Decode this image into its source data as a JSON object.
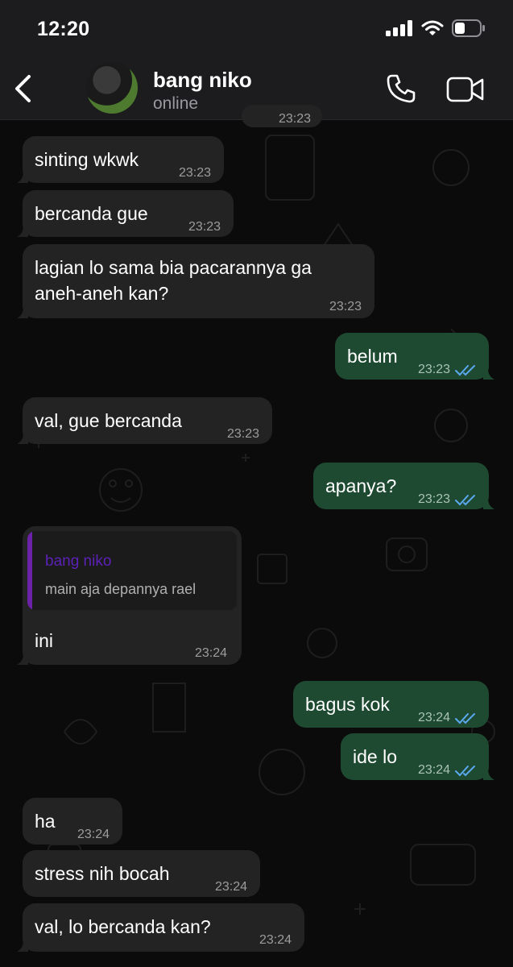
{
  "status_bar": {
    "time": "12:20"
  },
  "header": {
    "name": "bang niko",
    "status": "online"
  },
  "partial_top_time": "23:23",
  "messages": [
    {
      "text": "sinting wkwk",
      "time": "23:23"
    },
    {
      "text": "bercanda gue",
      "time": "23:23"
    },
    {
      "text_line1": "lagian lo sama bia pacarannya ga",
      "text_line2": "aneh-aneh kan?",
      "time": "23:23"
    },
    {
      "text": "belum",
      "time": "23:23"
    },
    {
      "text": "val, gue bercanda",
      "time": "23:23"
    },
    {
      "text": "apanya?",
      "time": "23:23"
    },
    {
      "reply_author": "bang niko",
      "reply_text": "main aja depannya rael",
      "text": "ini",
      "time": "23:24"
    },
    {
      "text": "bagus kok",
      "time": "23:24"
    },
    {
      "text": "ide lo",
      "time": "23:24"
    },
    {
      "text": "ha",
      "time": "23:24"
    },
    {
      "text": "stress nih bocah",
      "time": "23:24"
    },
    {
      "text": "val, lo bercanda kan?",
      "time": "23:24"
    }
  ],
  "colors": {
    "incoming_bubble": "#232323",
    "outgoing_bubble": "#1f4a32",
    "read_ticks": "#5aa9f0",
    "reply_bar": "#6b21a8"
  },
  "icons": [
    "back-chevron-icon",
    "phone-icon",
    "video-camera-icon",
    "signal-icon",
    "wifi-icon",
    "battery-icon",
    "double-check-icon"
  ]
}
